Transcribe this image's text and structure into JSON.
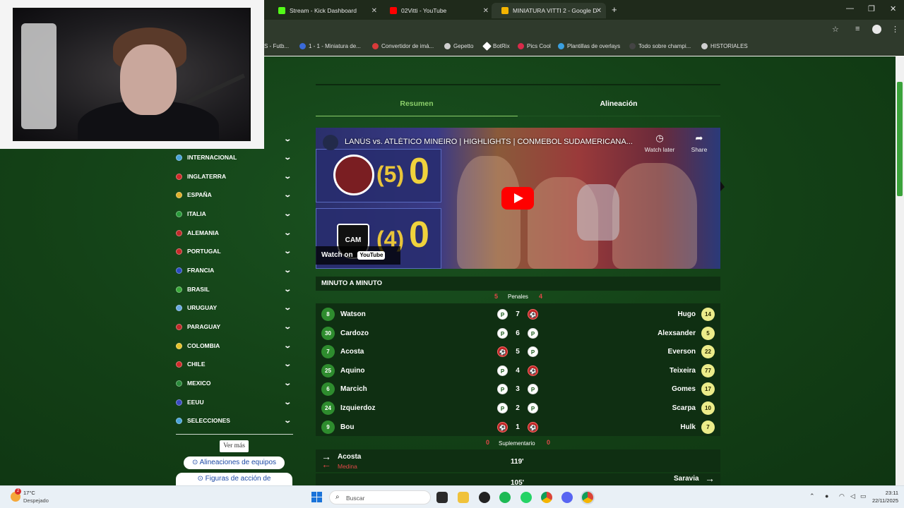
{
  "browser": {
    "tabs": [
      {
        "title": "Stream - Kick Dashboard",
        "favicon_color": "#53fc18"
      },
      {
        "title": "02Vitti - YouTube",
        "favicon_color": "#ff0000"
      },
      {
        "title": "MINIATURA VITTI 2 - Google D",
        "favicon_color": "#f4b400"
      }
    ],
    "new_tab": "+",
    "bookmarks": [
      "S - Futb...",
      "1 - 1 - Miniatura de...",
      "Convertidor de imá...",
      "Gepetto",
      "BotRix",
      "Pics Cool",
      "Plantillas de overlays",
      "Todo sobre champi...",
      "HISTORIALES"
    ]
  },
  "sidebar": {
    "items": [
      {
        "label": "",
        "flag_color": "#1d5a22"
      },
      {
        "label": "INTERNACIONAL",
        "flag_color": "#4aa3d9"
      },
      {
        "label": "INGLATERRA",
        "flag_color": "#d02a2a"
      },
      {
        "label": "ESPAÑA",
        "flag_color": "#e0b02a"
      },
      {
        "label": "ITALIA",
        "flag_color": "#2a9a3a"
      },
      {
        "label": "ALEMANIA",
        "flag_color": "#c02a2a"
      },
      {
        "label": "PORTUGAL",
        "flag_color": "#c62a2a"
      },
      {
        "label": "FRANCIA",
        "flag_color": "#2a4ac0"
      },
      {
        "label": "BRASIL",
        "flag_color": "#3aa83a"
      },
      {
        "label": "URUGUAY",
        "flag_color": "#6aa8e0"
      },
      {
        "label": "PARAGUAY",
        "flag_color": "#c02a2a"
      },
      {
        "label": "COLOMBIA",
        "flag_color": "#e6c22a"
      },
      {
        "label": "CHILE",
        "flag_color": "#d02a2a"
      },
      {
        "label": "MEXICO",
        "flag_color": "#2a8a3a"
      },
      {
        "label": "EEUU",
        "flag_color": "#3a4ac0"
      },
      {
        "label": "SELECCIONES",
        "flag_color": "#4aa3d9"
      }
    ],
    "ver_mas": "Ver más",
    "alineaciones_btn": "⊙ Alineaciones de equipos",
    "figuras_btn": "⊙ Figuras de acción de"
  },
  "main": {
    "tabs": {
      "resumen": "Resumen",
      "alineacion": "Alineación"
    },
    "video": {
      "title": "LANÚS vs. ATLÉTICO MINEIRO | HIGHLIGHTS | CONMEBOL SUDAMERICANA...",
      "watch_later": "Watch later",
      "share": "Share",
      "watch_on": "Watch on",
      "youtube": "YouTube",
      "home_pens": "(5)",
      "home_goals": "0",
      "away_pens": "(4)",
      "away_goals": "0",
      "away_crest": "CAM"
    },
    "minuto_a_minuto": "MINUTO A MINUTO",
    "penalties": {
      "label": "Penales",
      "home_score": "5",
      "away_score": "4",
      "rows": [
        {
          "home_num": "8",
          "home_name": "Watson",
          "home_result": "scored",
          "round": "7",
          "away_result": "missed",
          "away_name": "Hugo",
          "away_num": "14"
        },
        {
          "home_num": "30",
          "home_name": "Cardozo",
          "home_result": "scored",
          "round": "6",
          "away_result": "scored",
          "away_name": "Alexsander",
          "away_num": "5"
        },
        {
          "home_num": "7",
          "home_name": "Acosta",
          "home_result": "missed",
          "round": "5",
          "away_result": "scored",
          "away_name": "Everson",
          "away_num": "22"
        },
        {
          "home_num": "25",
          "home_name": "Aquino",
          "home_result": "scored",
          "round": "4",
          "away_result": "missed",
          "away_name": "Teixeira",
          "away_num": "77"
        },
        {
          "home_num": "6",
          "home_name": "Marcich",
          "home_result": "scored",
          "round": "3",
          "away_result": "scored",
          "away_name": "Gomes",
          "away_num": "17"
        },
        {
          "home_num": "24",
          "home_name": "Izquierdoz",
          "home_result": "scored",
          "round": "2",
          "away_result": "scored",
          "away_name": "Scarpa",
          "away_num": "10"
        },
        {
          "home_num": "9",
          "home_name": "Bou",
          "home_result": "missed",
          "round": "1",
          "away_result": "missed",
          "away_name": "Hulk",
          "away_num": "7"
        }
      ]
    },
    "suplementario": {
      "label": "Suplementario",
      "home_score": "0",
      "away_score": "0"
    },
    "events": [
      {
        "player_in": "Acosta",
        "player_out": "Medina",
        "minute": "119'"
      },
      {
        "player_in": "Saravia",
        "minute": "105'"
      }
    ]
  },
  "taskbar": {
    "temp": "17°C",
    "weather": "Despejado",
    "weather_badge": "2",
    "search_placeholder": "Buscar",
    "time": "23:11",
    "date": "22/11/2025"
  }
}
